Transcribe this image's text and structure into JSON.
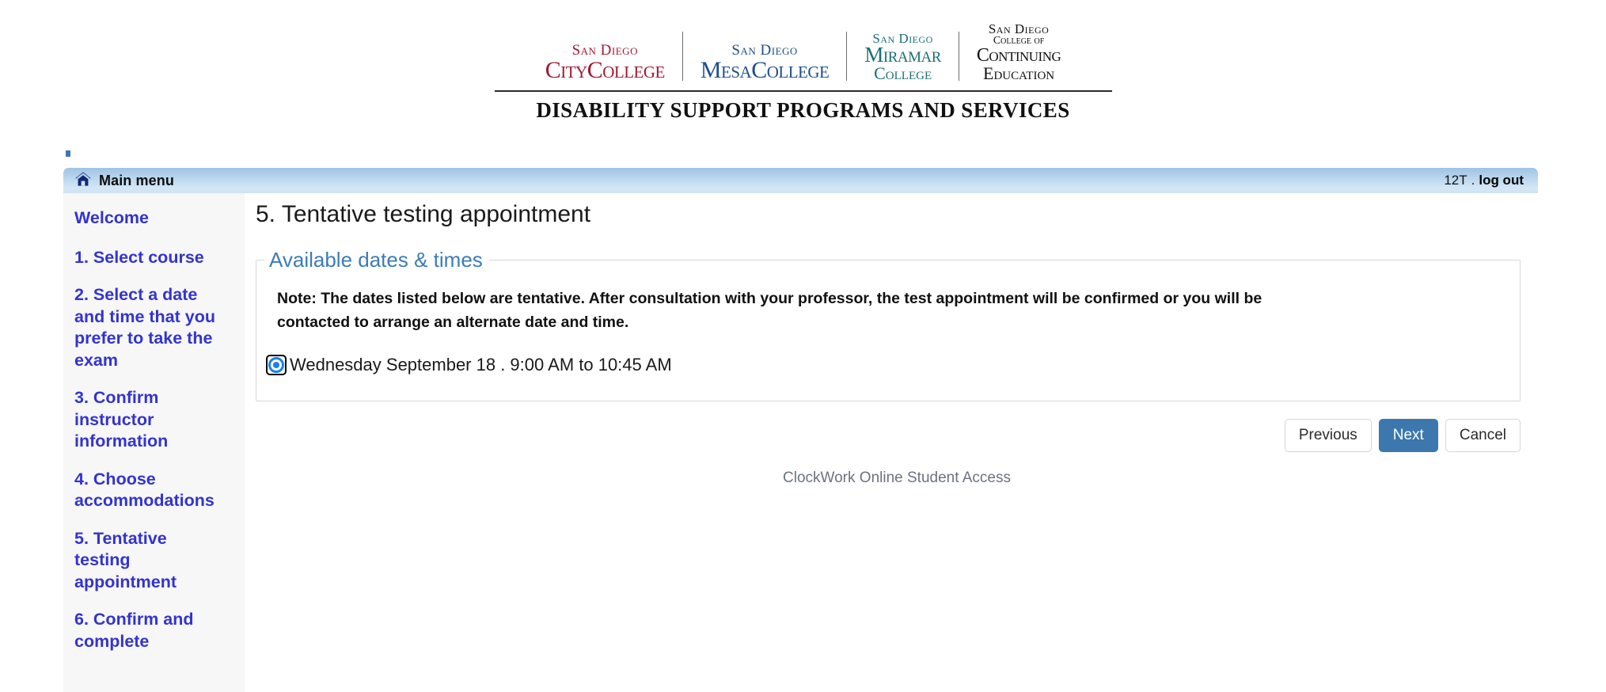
{
  "branding": {
    "logos": [
      {
        "name": "san-diego-city-college",
        "top": "San Diego",
        "main": "CityCollege",
        "color": "#9e1b32"
      },
      {
        "name": "san-diego-mesa-college",
        "top": "San Diego",
        "main": "MesaCollege",
        "color": "#1f4e8c"
      },
      {
        "name": "san-diego-miramar-college",
        "top": "San Diego",
        "main": "Miramar",
        "sub": "College",
        "color": "#1b6f72"
      },
      {
        "name": "san-diego-college-of-continuing-education",
        "top": "San Diego",
        "top2": "College of",
        "main": "Continuing",
        "sub": "Education",
        "color": "#111111"
      }
    ],
    "title": "DISABILITY SUPPORT PROGRAMS AND SERVICES"
  },
  "navbar": {
    "home_icon": "home-icon",
    "main_menu_label": "Main menu",
    "user": "12T",
    "separator": ".",
    "logout_label": "log out"
  },
  "sidebar": {
    "items": [
      {
        "label": "Welcome"
      },
      {
        "label": "1. Select course"
      },
      {
        "label": "2. Select a date and time that you prefer to take the exam"
      },
      {
        "label": "3. Confirm instructor information"
      },
      {
        "label": "4. Choose accommodations"
      },
      {
        "label": "5. Tentative testing appointment"
      },
      {
        "label": "6. Confirm and complete"
      }
    ]
  },
  "main": {
    "page_title": "5. Tentative testing appointment",
    "panel": {
      "legend": "Available dates & times",
      "note": "Note: The dates listed below are tentative. After consultation with your professor, the test appointment will be confirmed or you will be contacted to arrange an alternate date and time.",
      "options": [
        {
          "label": "Wednesday September 18 . 9:00 AM to 10:45 AM",
          "selected": true
        }
      ]
    },
    "buttons": {
      "previous": "Previous",
      "next": "Next",
      "cancel": "Cancel"
    }
  },
  "footer": {
    "text": "ClockWork Online Student Access"
  },
  "colors": {
    "accent_blue": "#3c78ad",
    "link_blue": "#3333d1",
    "legend_blue": "#3c7cb8",
    "radio_blue": "#1a7ff0",
    "navbar_top": "#9fc3e3",
    "navbar_bottom": "#cfe3f4",
    "sidebar_bg": "#f7f7f7"
  }
}
